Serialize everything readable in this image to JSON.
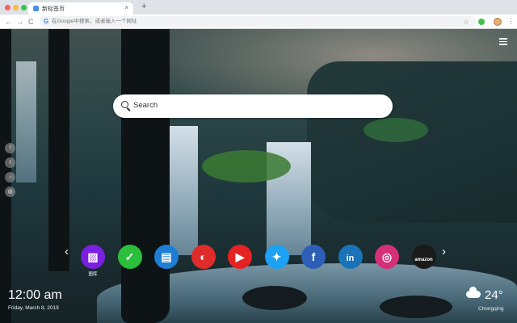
{
  "tab": {
    "title": "新标签页",
    "close_glyph": "×",
    "new_tab_glyph": "+"
  },
  "toolbar": {
    "back_glyph": "←",
    "forward_glyph": "→",
    "reload_glyph": "C",
    "omnibox_placeholder": "在Google中搜索，或者输入一个网址",
    "g_glyph": "G",
    "star_glyph": "☆",
    "menu_glyph": "⋮"
  },
  "search": {
    "placeholder": "Search"
  },
  "social": [
    "f",
    "t",
    "♪",
    "◍"
  ],
  "shortcuts": [
    {
      "name": "gallery",
      "label": "图库",
      "glyph": "▨",
      "color": "#7b1fe0"
    },
    {
      "name": "tasks",
      "label": "",
      "glyph": "✓",
      "color": "#2bbf3c"
    },
    {
      "name": "notes",
      "label": "",
      "glyph": "▤",
      "color": "#1e7ed6"
    },
    {
      "name": "games",
      "label": "",
      "glyph": "◐",
      "color": "#e02b2b"
    },
    {
      "name": "youtube",
      "label": "",
      "glyph": "▶",
      "color": "#e62222"
    },
    {
      "name": "twitter",
      "label": "",
      "glyph": "✦",
      "color": "#1da1f2"
    },
    {
      "name": "facebook",
      "label": "",
      "glyph": "f",
      "color": "#2d5fb8"
    },
    {
      "name": "linkedin",
      "label": "",
      "glyph": "in",
      "color": "#1a72b8"
    },
    {
      "name": "instagram",
      "label": "",
      "glyph": "◎",
      "color": "#d62f7a"
    },
    {
      "name": "amazon",
      "label": "",
      "glyph": "amazon",
      "color": "#1a1a1a"
    }
  ],
  "dock": {
    "prev_glyph": "‹",
    "next_glyph": "›"
  },
  "clock": {
    "time": "12:00 am",
    "date": "Friday, March 8, 2019"
  },
  "weather": {
    "temp": "24°",
    "city": "Chongqing"
  }
}
